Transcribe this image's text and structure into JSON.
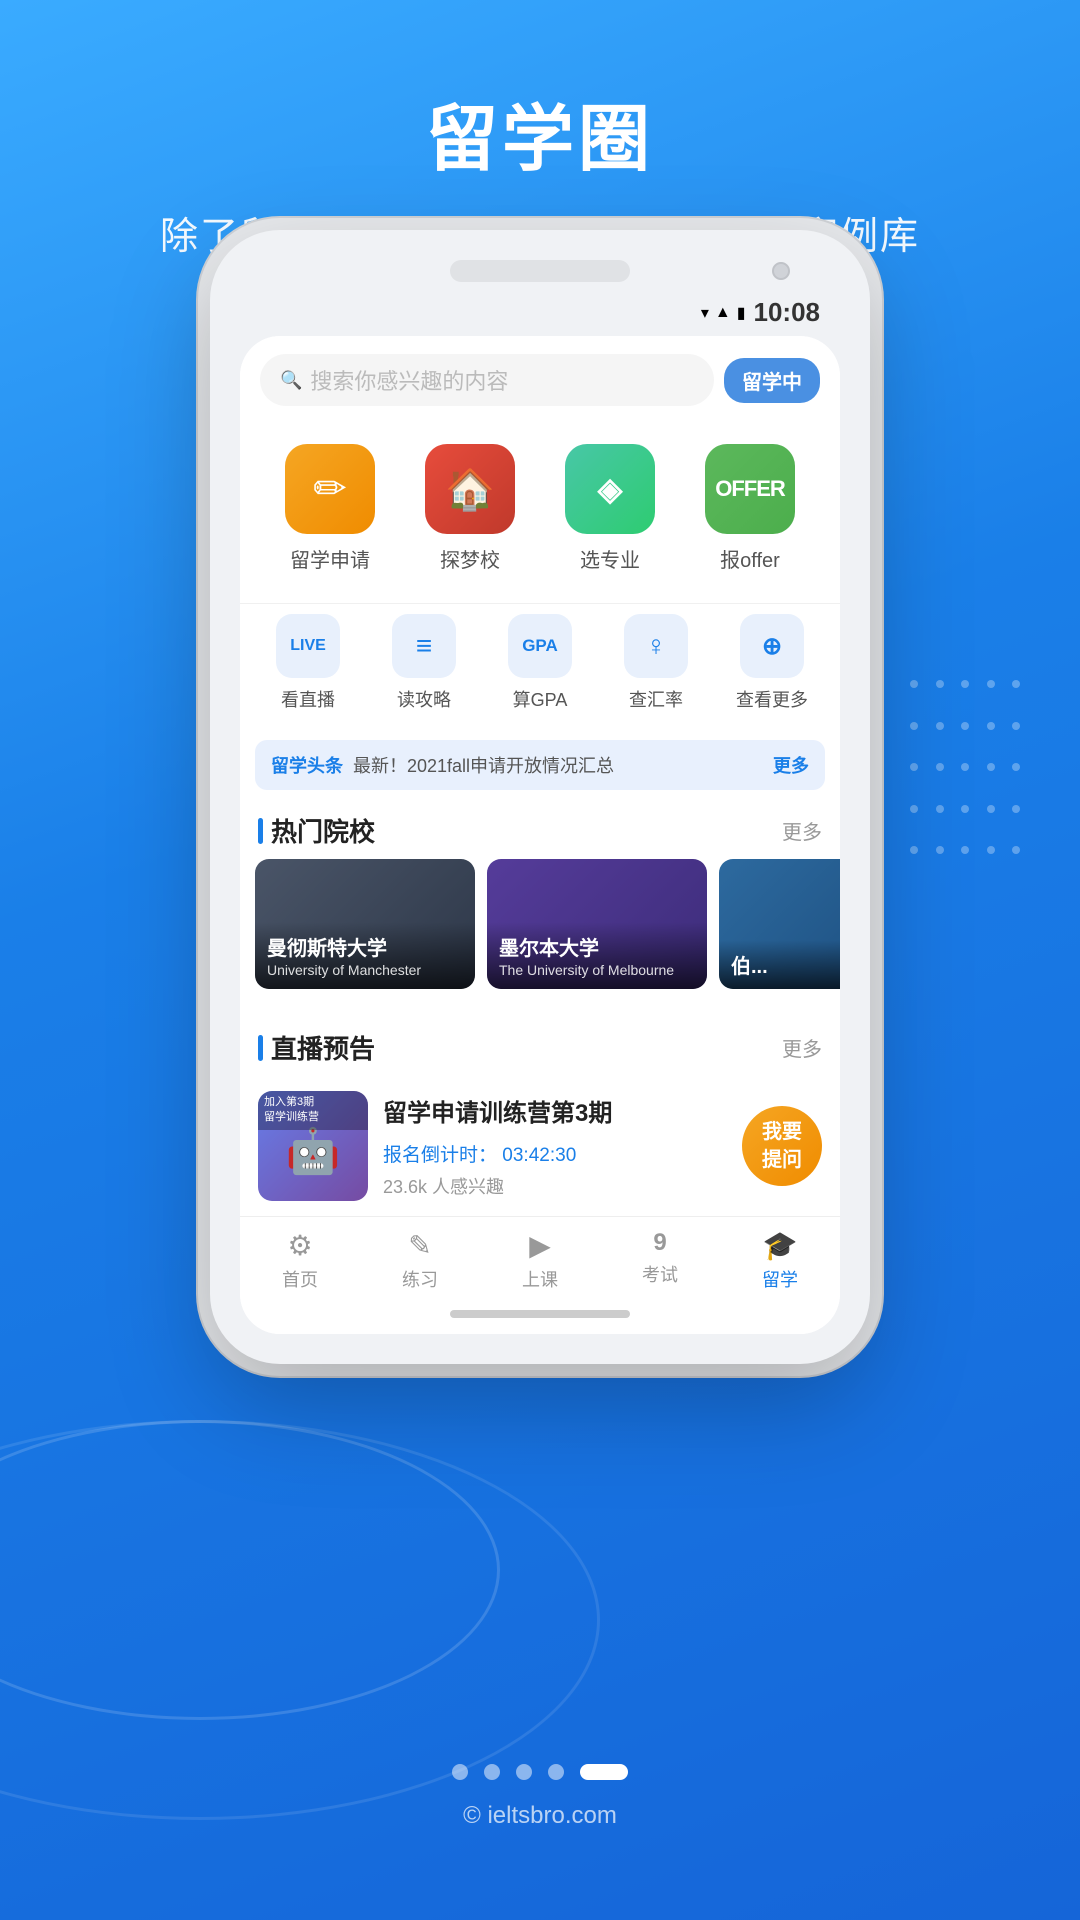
{
  "page": {
    "background_color": "#2b8ae8",
    "title": "留学圈",
    "subtitle": "除了留学交流群，还有问答、直播、案例库"
  },
  "status_bar": {
    "time": "10:08",
    "wifi": "▼",
    "signal": "▲",
    "battery": "🔋"
  },
  "search": {
    "placeholder": "搜索你感兴趣的内容",
    "badge": "留学中"
  },
  "main_icons": [
    {
      "label": "留学申请",
      "icon": "✏️",
      "color": "orange"
    },
    {
      "label": "探梦校",
      "icon": "🏠",
      "color": "red"
    },
    {
      "label": "选专业",
      "icon": "◈",
      "color": "teal"
    },
    {
      "label": "报offer",
      "icon": "OFFER",
      "color": "green"
    }
  ],
  "secondary_icons": [
    {
      "label": "看直播",
      "icon": "LIVE"
    },
    {
      "label": "读攻略",
      "icon": "≡"
    },
    {
      "label": "算GPA",
      "icon": "GPA"
    },
    {
      "label": "查汇率",
      "icon": "¥"
    },
    {
      "label": "查看更多",
      "icon": "⊕"
    }
  ],
  "news": {
    "tag": "留学头条",
    "text": "最新！2021fall申请开放情况汇总",
    "more": "更多"
  },
  "hot_schools": {
    "title": "热门院校",
    "more": "更多",
    "schools": [
      {
        "name_cn": "曼彻斯特大学",
        "name_en": "University of Manchester",
        "color": "manchester"
      },
      {
        "name_cn": "墨尔本大学",
        "name_en": "The University of Melbourne",
        "color": "melbourne"
      },
      {
        "name_cn": "...",
        "name_en": "",
        "color": "third"
      }
    ]
  },
  "livestream": {
    "title": "直播预告",
    "more": "更多",
    "card": {
      "title": "留学申请训练营第3期",
      "thumb_text": "加入第3期\n留学训练营",
      "countdown_label": "报名倒计时：",
      "countdown": "03:42:30",
      "interest": "23.6k 人感兴趣",
      "cta": "我要\n提问"
    }
  },
  "bottom_nav": [
    {
      "label": "首页",
      "icon": "⚙",
      "active": false
    },
    {
      "label": "练习",
      "icon": "✎",
      "active": false
    },
    {
      "label": "上课",
      "icon": "▶",
      "active": false
    },
    {
      "label": "考试",
      "icon": "9",
      "active": false
    },
    {
      "label": "留学",
      "icon": "🎓",
      "active": true
    }
  ],
  "pagination": {
    "total": 5,
    "active": 4
  },
  "copyright": "© ieltsbro.com"
}
